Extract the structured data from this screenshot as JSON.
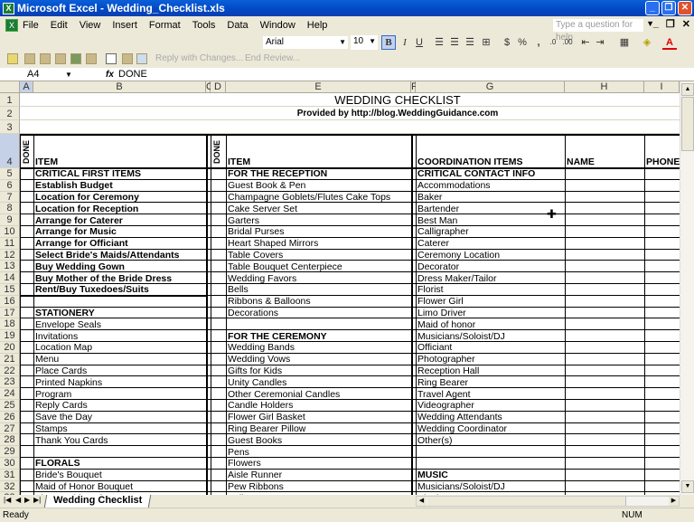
{
  "window": {
    "title": "Microsoft Excel - Wedding_Checklist.xls",
    "app_icon": "excel-icon",
    "controls": [
      "minimize",
      "restore",
      "close"
    ]
  },
  "menu": {
    "items": [
      "File",
      "Edit",
      "View",
      "Insert",
      "Format",
      "Tools",
      "Data",
      "Window",
      "Help"
    ],
    "help_placeholder": "Type a question for help"
  },
  "formatting_toolbar": {
    "font": "Arial",
    "size": "10",
    "bold_active": true,
    "buttons": [
      "bold",
      "italic",
      "underline",
      "align-left",
      "center",
      "align-right",
      "merge-center",
      "currency",
      "percent",
      "comma",
      "increase-decimal",
      "decrease-decimal",
      "decrease-indent",
      "increase-indent",
      "borders",
      "fill-color",
      "font-color"
    ]
  },
  "reviewing_toolbar": {
    "reply_label": "Reply with Changes...",
    "end_review_label": "End Review..."
  },
  "formula_bar": {
    "name_box": "A4",
    "fx": "fx",
    "value": "DONE"
  },
  "columns": [
    "A",
    "B",
    "C",
    "D",
    "E",
    "F",
    "G",
    "H",
    "I"
  ],
  "selected_column": "A",
  "selected_row": "4",
  "sheet": {
    "title": "WEDDING CHECKLIST",
    "subtitle": "Provided by http://blog.WeddingGuidance.com",
    "headers": {
      "done1": "DONE",
      "item1": "ITEM",
      "done2": "DONE",
      "item2": "ITEM",
      "coord": "COORDINATION ITEMS",
      "name": "NAME",
      "phone": "PHONE #"
    },
    "rows": [
      {
        "row": "5",
        "b": "CRITICAL FIRST ITEMS",
        "b_bold": true,
        "e": "FOR THE RECEPTION",
        "e_bold": true,
        "g": "CRITICAL CONTACT INFO",
        "g_bold": true
      },
      {
        "row": "6",
        "b": "Establish Budget",
        "b_bold": true,
        "e": "Guest Book & Pen",
        "g": "Accommodations"
      },
      {
        "row": "7",
        "b": "Location for Ceremony",
        "b_bold": true,
        "e": "Champagne Goblets/Flutes Cake Tops",
        "g": "Baker"
      },
      {
        "row": "8",
        "b": "Location for Reception",
        "b_bold": true,
        "e": "Cake Server Set",
        "g": "Bartender"
      },
      {
        "row": "9",
        "b": "Arrange for Caterer",
        "b_bold": true,
        "e": "Garters",
        "g": "Best Man"
      },
      {
        "row": "10",
        "b": "Arrange for Music",
        "b_bold": true,
        "e": "Bridal Purses",
        "g": "Calligrapher"
      },
      {
        "row": "11",
        "b": "Arrange for Officiant",
        "b_bold": true,
        "e": "Heart Shaped Mirrors",
        "g": "Caterer"
      },
      {
        "row": "12",
        "b": "Select Bride's Maids/Attendants",
        "b_bold": true,
        "e": "Table Covers",
        "g": "Ceremony Location"
      },
      {
        "row": "13",
        "b": "Buy Wedding Gown",
        "b_bold": true,
        "e": "Table Bouquet Centerpiece",
        "g": "Decorator"
      },
      {
        "row": "14",
        "b": "Buy Mother of the Bride Dress",
        "b_bold": true,
        "e": "Wedding Favors",
        "g": "Dress Maker/Tailor"
      },
      {
        "row": "15",
        "b": "Rent/Buy Tuxedoes/Suits",
        "b_bold": true,
        "e": "Bells",
        "g": "Florist"
      },
      {
        "row": "16",
        "b": "",
        "e": "Ribbons & Balloons",
        "g": "Flower Girl"
      },
      {
        "row": "17",
        "b": " STATIONERY",
        "b_bold": true,
        "e": "Decorations",
        "g": "Limo Driver"
      },
      {
        "row": "18",
        "b": "Envelope Seals",
        "e": "",
        "g": "Maid of honor"
      },
      {
        "row": "19",
        "b": "Invitations",
        "e": "FOR THE CEREMONY",
        "e_bold": true,
        "g": "Musicians/Soloist/DJ"
      },
      {
        "row": "20",
        "b": "Location Map",
        "e": "Wedding Bands",
        "g": "Officiant"
      },
      {
        "row": "21",
        "b": "Menu",
        "e": "Wedding Vows",
        "g": "Photographer"
      },
      {
        "row": "22",
        "b": "Place Cards",
        "e": "Gifts for Kids",
        "g": "Reception Hall"
      },
      {
        "row": "23",
        "b": "Printed Napkins",
        "e": "Unity Candles",
        "g": "Ring Bearer"
      },
      {
        "row": "24",
        "b": "Program",
        "e": "Other Ceremonial Candles",
        "g": "Travel Agent"
      },
      {
        "row": "25",
        "b": "Reply Cards",
        "e": "Candle Holders",
        "g": "Videographer"
      },
      {
        "row": "26",
        "b": "Save the Day",
        "e": "Flower Girl Basket",
        "g": "Wedding Attendants"
      },
      {
        "row": "27",
        "b": "Stamps",
        "e": "Ring Bearer Pillow",
        "g": "Wedding Coordinator"
      },
      {
        "row": "28",
        "b": "Thank You Cards",
        "e": "Guest Books",
        "g": "Other(s)"
      },
      {
        "row": "29",
        "b": "",
        "e": "Pens",
        "g": ""
      },
      {
        "row": "30",
        "b": "FLORALS",
        "b_bold": true,
        "e": "Flowers",
        "g": ""
      },
      {
        "row": "31",
        "b": "Bride's Bouquet",
        "e": "Aisle Runner",
        "g": "MUSIC",
        "g_bold": true
      },
      {
        "row": "32",
        "b": "Maid of Honor Bouquet",
        "e": "Pew Ribbons",
        "g": "Musicians/Soloist/DJ"
      },
      {
        "row": "33",
        "b": "Flower Girl Basket",
        "e": "Bell...",
        "g": "Pianist"
      }
    ]
  },
  "sheet_tabs": {
    "active": "Wedding Checklist"
  },
  "status_bar": {
    "left": "Ready",
    "num": "NUM"
  }
}
